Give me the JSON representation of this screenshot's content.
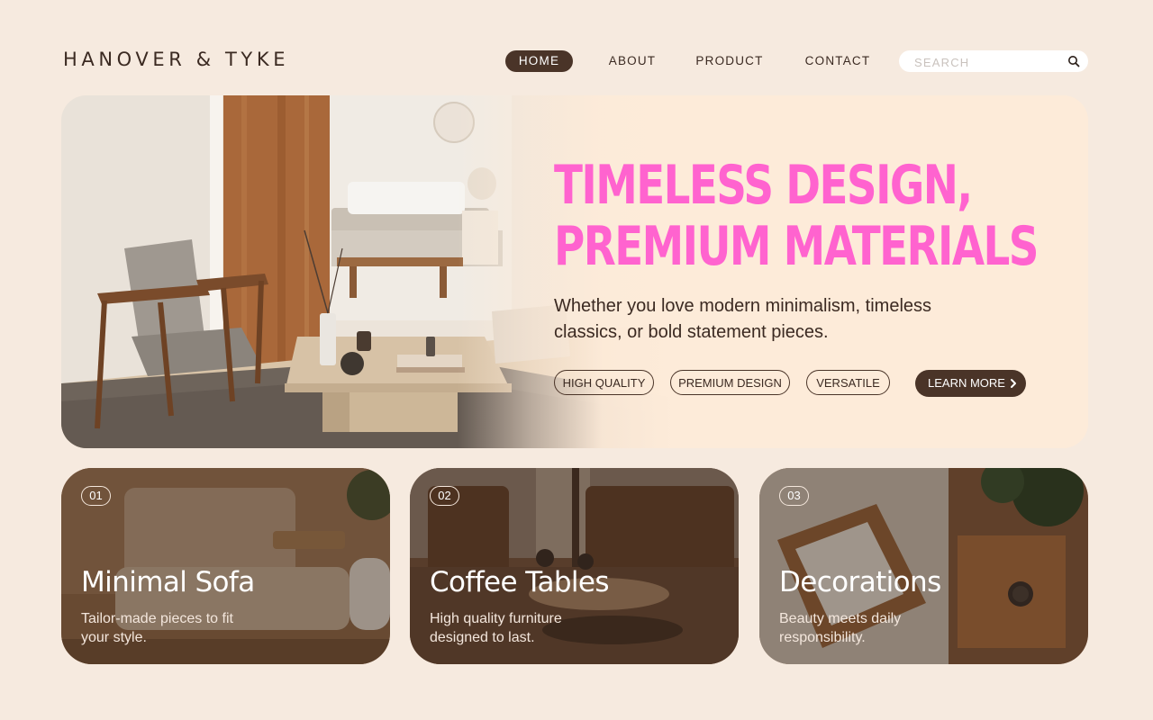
{
  "brand": {
    "name": "HANOVER & TYKE"
  },
  "nav": {
    "home": "HOME",
    "about": "ABOUT",
    "product": "PRODUCT",
    "contact": "CONTACT",
    "active": "HOME"
  },
  "search": {
    "placeholder": "SEARCH",
    "value": "",
    "icon": "search-icon"
  },
  "hero": {
    "title_line1": "TIMELESS DESIGN,",
    "title_line2": "PREMIUM MATERIALS",
    "subtitle": "Whether you love modern minimalism, timeless classics, or bold statement pieces.",
    "tags": [
      "HIGH QUALITY",
      "PREMIUM DESIGN",
      "VERSATILE"
    ],
    "cta": "LEARN MORE",
    "cta_icon": "chevron-right-icon",
    "image": "living room with armchair and coffee table"
  },
  "cards": [
    {
      "number": "01",
      "title": "Minimal Sofa",
      "description": "Tailor-made pieces to fit your style."
    },
    {
      "number": "02",
      "title": "Coffee Tables",
      "description": "High quality furniture designed to last."
    },
    {
      "number": "03",
      "title": "Decorations",
      "description": "Beauty meets daily responsibility."
    }
  ],
  "colors": {
    "background": "#f6eadf",
    "hero_panel": "#fdebd9",
    "accent_pink": "#ff63cf",
    "dark_brown": "#4a3428",
    "text": "#3b2a22"
  }
}
